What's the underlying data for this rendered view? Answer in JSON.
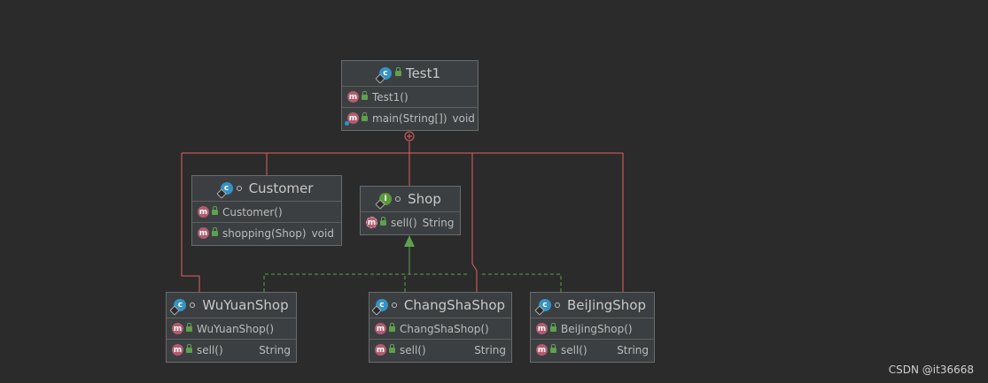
{
  "colors": {
    "background": "#2b2b2b",
    "box": "#3c3f41",
    "inner_class_line": "#e06060",
    "implements_line": "#5fa04e"
  },
  "classes": {
    "test1": {
      "name": "Test1",
      "icon": "class-icon",
      "members": [
        {
          "name": "Test1()",
          "type": ""
        },
        {
          "name": "main(String[])",
          "type": "void"
        }
      ]
    },
    "customer": {
      "name": "Customer",
      "icon": "class-icon",
      "members": [
        {
          "name": "Customer()",
          "type": ""
        },
        {
          "name": "shopping(Shop)",
          "type": "void"
        }
      ]
    },
    "shop": {
      "name": "Shop",
      "icon": "interface-icon",
      "members": [
        {
          "name": "sell()",
          "type": "String"
        }
      ]
    },
    "wuyuanshop": {
      "name": "WuYuanShop",
      "icon": "class-icon",
      "members": [
        {
          "name": "WuYuanShop()",
          "type": ""
        },
        {
          "name": "sell()",
          "type": "String"
        }
      ]
    },
    "changshashop": {
      "name": "ChangShaShop",
      "icon": "class-icon",
      "members": [
        {
          "name": "ChangShaShop()",
          "type": ""
        },
        {
          "name": "sell()",
          "type": "String"
        }
      ]
    },
    "beijingshop": {
      "name": "BeiJingShop",
      "icon": "class-icon",
      "members": [
        {
          "name": "BeiJingShop()",
          "type": ""
        },
        {
          "name": "sell()",
          "type": "String"
        }
      ]
    }
  },
  "watermark": "CSDN @it36668"
}
